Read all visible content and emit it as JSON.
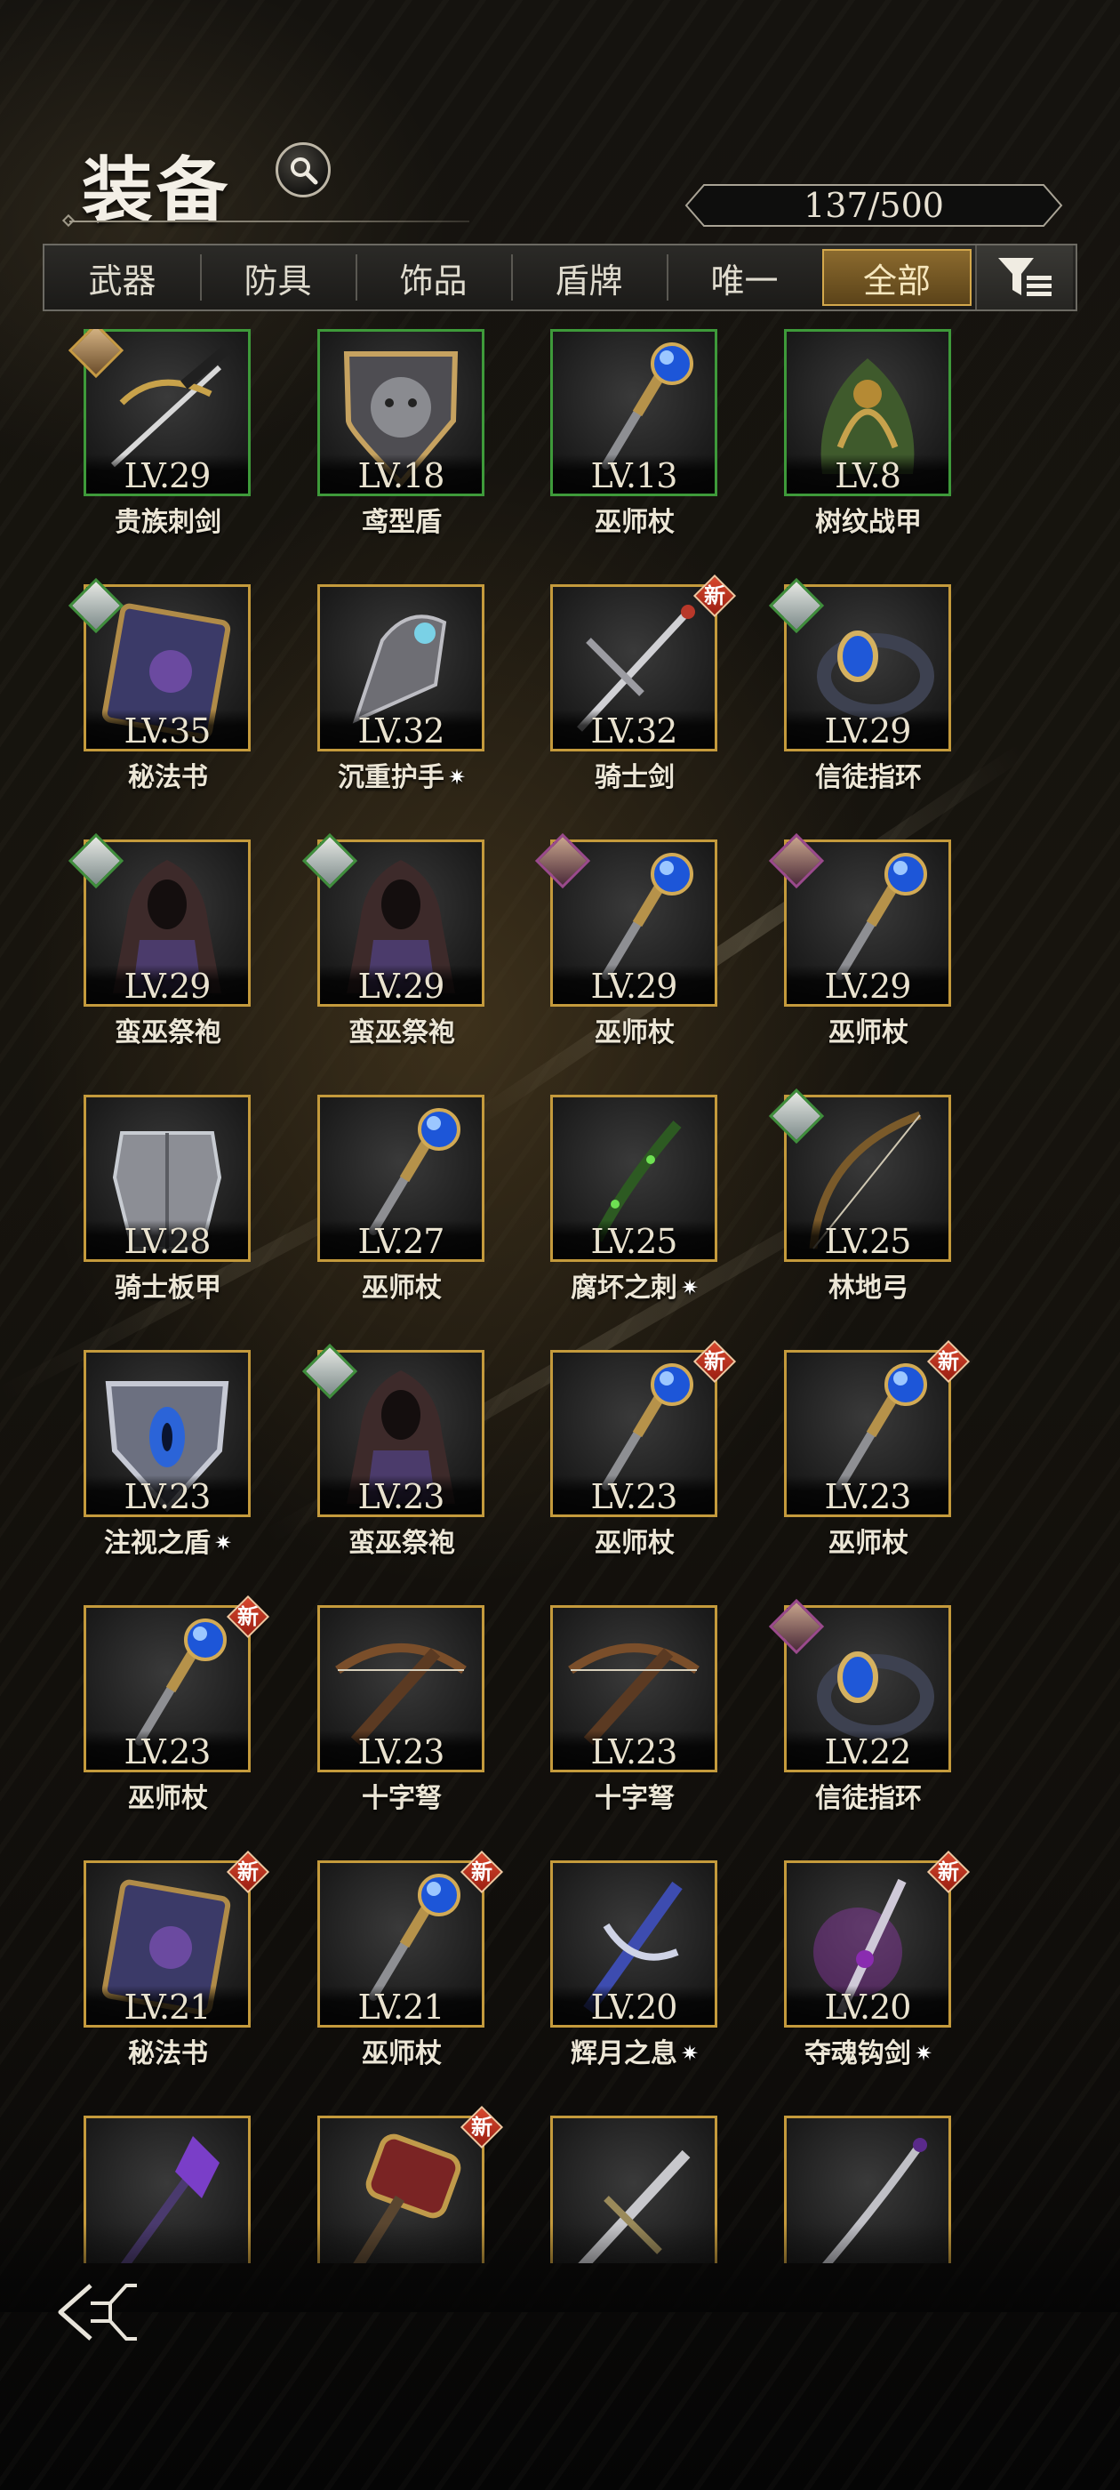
{
  "header": {
    "title": "装备",
    "capacity": "137/500"
  },
  "tabs": [
    "武器",
    "防具",
    "饰品",
    "盾牌",
    "唯一",
    "全部"
  ],
  "items": [
    {
      "level": "LV.29",
      "name": "贵族刺剑",
      "icon": "rapier-icon",
      "frame": "green",
      "portrait": "gold",
      "new": false,
      "star": false
    },
    {
      "level": "LV.18",
      "name": "鸢型盾",
      "icon": "lion-shield-icon",
      "frame": "green",
      "portrait": null,
      "new": false,
      "star": false
    },
    {
      "level": "LV.13",
      "name": "巫师杖",
      "icon": "wizard-staff-icon",
      "frame": "green",
      "portrait": null,
      "new": false,
      "star": false
    },
    {
      "level": "LV.8",
      "name": "树纹战甲",
      "icon": "vine-armor-icon",
      "frame": "green",
      "portrait": null,
      "new": false,
      "star": false
    },
    {
      "level": "LV.35",
      "name": "秘法书",
      "icon": "spellbook-icon",
      "frame": "gold",
      "portrait": "teal",
      "new": false,
      "star": false
    },
    {
      "level": "LV.32",
      "name": "沉重护手",
      "icon": "gauntlet-icon",
      "frame": "gold",
      "portrait": null,
      "new": false,
      "star": true
    },
    {
      "level": "LV.32",
      "name": "骑士剑",
      "icon": "longsword-icon",
      "frame": "gold",
      "portrait": null,
      "new": true,
      "star": false
    },
    {
      "level": "LV.29",
      "name": "信徒指环",
      "icon": "ring-icon",
      "frame": "gold",
      "portrait": "teal",
      "new": false,
      "star": false
    },
    {
      "level": "LV.29",
      "name": "蛮巫祭袍",
      "icon": "robe-icon",
      "frame": "gold",
      "portrait": "teal",
      "new": false,
      "star": false
    },
    {
      "level": "LV.29",
      "name": "蛮巫祭袍",
      "icon": "robe-icon",
      "frame": "gold",
      "portrait": "teal",
      "new": false,
      "star": false
    },
    {
      "level": "LV.29",
      "name": "巫师杖",
      "icon": "wizard-staff-icon",
      "frame": "gold",
      "portrait": "purple",
      "new": false,
      "star": false
    },
    {
      "level": "LV.29",
      "name": "巫师杖",
      "icon": "wizard-staff-icon",
      "frame": "gold",
      "portrait": "purple",
      "new": false,
      "star": false
    },
    {
      "level": "LV.28",
      "name": "骑士板甲",
      "icon": "plate-armor-icon",
      "frame": "gold",
      "portrait": null,
      "new": false,
      "star": false
    },
    {
      "level": "LV.27",
      "name": "巫师杖",
      "icon": "wizard-staff-icon",
      "frame": "gold",
      "portrait": null,
      "new": false,
      "star": false
    },
    {
      "level": "LV.25",
      "name": "腐坏之刺",
      "icon": "thorn-dagger-icon",
      "frame": "gold",
      "portrait": null,
      "new": false,
      "star": true
    },
    {
      "level": "LV.25",
      "name": "林地弓",
      "icon": "bow-icon",
      "frame": "gold",
      "portrait": "teal",
      "new": false,
      "star": false
    },
    {
      "level": "LV.23",
      "name": "注视之盾",
      "icon": "eye-shield-icon",
      "frame": "gold",
      "portrait": null,
      "new": false,
      "star": true
    },
    {
      "level": "LV.23",
      "name": "蛮巫祭袍",
      "icon": "robe-icon",
      "frame": "gold",
      "portrait": "teal",
      "new": false,
      "star": false
    },
    {
      "level": "LV.23",
      "name": "巫师杖",
      "icon": "wizard-staff-icon",
      "frame": "gold",
      "portrait": null,
      "new": true,
      "star": false
    },
    {
      "level": "LV.23",
      "name": "巫师杖",
      "icon": "wizard-staff-icon",
      "frame": "gold",
      "portrait": null,
      "new": true,
      "star": false
    },
    {
      "level": "LV.23",
      "name": "巫师杖",
      "icon": "wizard-staff-icon",
      "frame": "gold",
      "portrait": null,
      "new": true,
      "star": false
    },
    {
      "level": "LV.23",
      "name": "十字弩",
      "icon": "crossbow-icon",
      "frame": "gold",
      "portrait": null,
      "new": false,
      "star": false
    },
    {
      "level": "LV.23",
      "name": "十字弩",
      "icon": "crossbow-icon",
      "frame": "gold",
      "portrait": null,
      "new": false,
      "star": false
    },
    {
      "level": "LV.22",
      "name": "信徒指环",
      "icon": "ring-icon",
      "frame": "gold",
      "portrait": "purple",
      "new": false,
      "star": false
    },
    {
      "level": "LV.21",
      "name": "秘法书",
      "icon": "spellbook-icon",
      "frame": "gold",
      "portrait": null,
      "new": true,
      "star": false
    },
    {
      "level": "LV.21",
      "name": "巫师杖",
      "icon": "wizard-staff-icon",
      "frame": "gold",
      "portrait": null,
      "new": true,
      "star": false
    },
    {
      "level": "LV.20",
      "name": "辉月之息",
      "icon": "moon-sword-icon",
      "frame": "gold",
      "portrait": null,
      "new": false,
      "star": true
    },
    {
      "level": "LV.20",
      "name": "夺魂钩剑",
      "icon": "soul-sword-icon",
      "frame": "gold",
      "portrait": null,
      "new": true,
      "star": true
    },
    {
      "level": "",
      "name": "",
      "icon": "crystal-scepter-icon",
      "frame": "gold",
      "portrait": null,
      "new": false,
      "star": false
    },
    {
      "level": "",
      "name": "",
      "icon": "war-hammer-icon",
      "frame": "gold",
      "portrait": null,
      "new": true,
      "star": false
    },
    {
      "level": "",
      "name": "",
      "icon": "broadsword-icon",
      "frame": "gold",
      "portrait": null,
      "new": false,
      "star": false
    },
    {
      "level": "",
      "name": "",
      "icon": "saber-icon",
      "frame": "gold",
      "portrait": null,
      "new": false,
      "star": false
    }
  ],
  "labels": {
    "new_badge": "新",
    "enhanced_star": "✷"
  }
}
